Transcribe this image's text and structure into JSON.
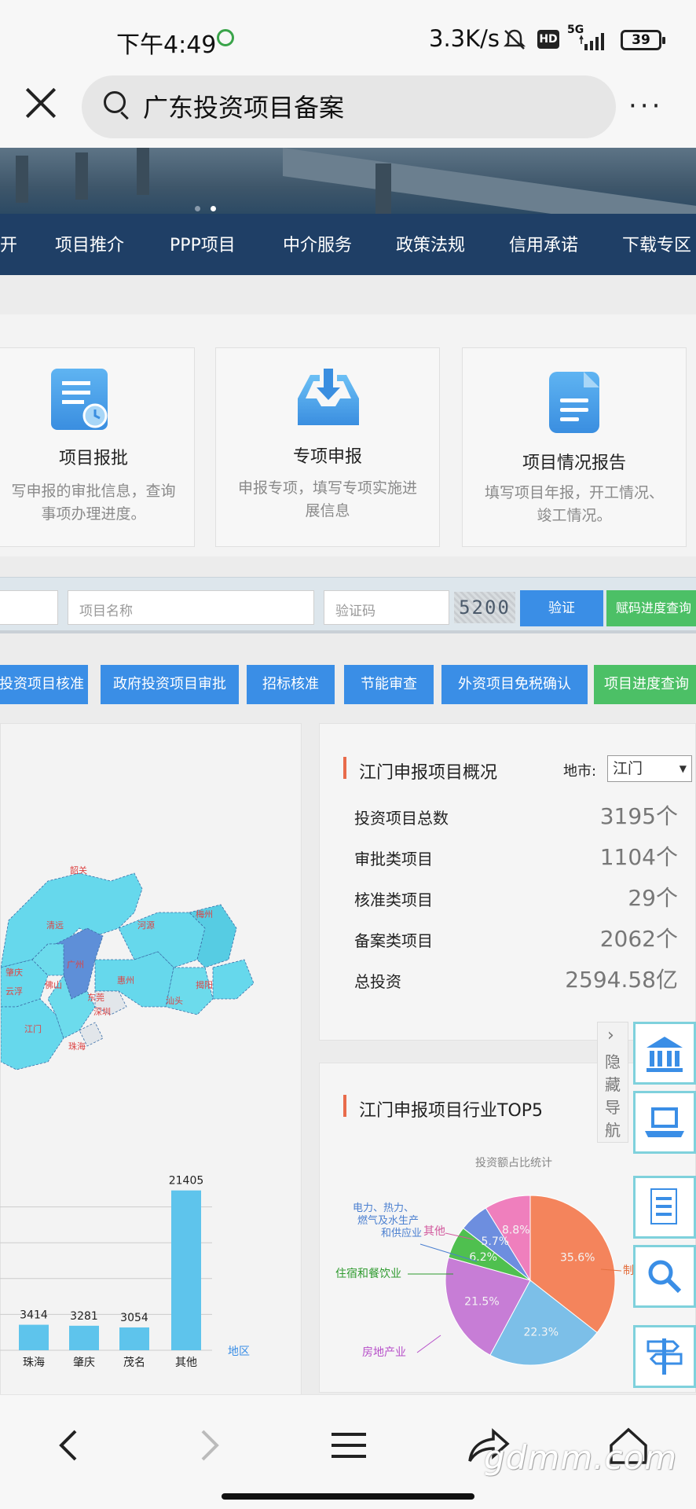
{
  "status_bar": {
    "time": "下午4:49",
    "network_speed": "3.3K/s",
    "hd": "HD",
    "network_type": "5G",
    "battery": "39"
  },
  "browser": {
    "search_query": "广东投资项目备案",
    "more": "···"
  },
  "nav": {
    "items": [
      "开",
      "项目推介",
      "PPP项目",
      "中介服务",
      "政策法规",
      "信用承诺",
      "下载专区"
    ]
  },
  "services": [
    {
      "icon": "document-clock-icon",
      "title": "项目报批",
      "desc_line1": "写申报的审批信息，查询",
      "desc_line2": "事项办理进度。"
    },
    {
      "icon": "inbox-download-icon",
      "title": "专项申报",
      "desc_line1": "申报专项，填写专项实施进",
      "desc_line2": "展信息"
    },
    {
      "icon": "report-doc-icon",
      "title": "项目情况报告",
      "desc_line1": "填写项目年报，开工情况、",
      "desc_line2": "竣工情况。"
    }
  ],
  "query": {
    "project_name_placeholder": "项目名称",
    "captcha_placeholder": "验证码",
    "captcha_image_text": "5200",
    "verify_button": "验证",
    "progress_query_button": "赋码进度查询"
  },
  "categories": [
    "投资项目核准",
    "政府投资项目审批",
    "招标核准",
    "节能审查",
    "外资项目免税确认",
    "项目进度查询"
  ],
  "map": {
    "labels": [
      "韶关",
      "梅州",
      "清远",
      "河源",
      "肇庆",
      "广州",
      "惠州",
      "揭阳",
      "汕头",
      "佛山",
      "东莞",
      "江门",
      "深圳",
      "珠海",
      "云浮"
    ]
  },
  "summary": {
    "title": "江门申报项目概况",
    "city_label": "地市:",
    "city_value": "江门",
    "stats": [
      {
        "label": "投资项目总数",
        "value": "3195个"
      },
      {
        "label": "审批类项目",
        "value": "1104个"
      },
      {
        "label": "核准类项目",
        "value": "29个"
      },
      {
        "label": "备案类项目",
        "value": "2062个"
      },
      {
        "label": "总投资",
        "value": "2594.58亿"
      }
    ]
  },
  "side_toggle": {
    "chars": [
      "隐",
      "藏",
      "导",
      "航"
    ]
  },
  "side_icons": [
    "bank-icon",
    "laptop-icon",
    "list-doc-icon",
    "search-icon",
    "signpost-icon"
  ],
  "top5": {
    "title": "江门申报项目行业TOP5",
    "subtitle": "投资额占比统计"
  },
  "chart_data": [
    {
      "type": "bar",
      "categories": [
        "珠海",
        "肇庆",
        "茂名",
        "其他"
      ],
      "values": [
        3414,
        3281,
        3054,
        21405
      ],
      "xlabel": "地区",
      "ylim": [
        0,
        24000
      ]
    },
    {
      "type": "pie",
      "title": "投资额占比统计",
      "slices": [
        {
          "label": "制造业",
          "value": 35.6,
          "color": "#f4845c"
        },
        {
          "label": "",
          "value": 22.3,
          "color": "#7cbfe8"
        },
        {
          "label": "房地产业",
          "value": 21.5,
          "color": "#c77dd6"
        },
        {
          "label": "住宿和餐饮业",
          "value": 6.2,
          "color": "#4fc04f"
        },
        {
          "label": "电力、热力、燃气及水生产和供应业",
          "value": 5.7,
          "color": "#6d8edf"
        },
        {
          "label": "其他",
          "value": 8.8,
          "color": "#ef7fbd"
        }
      ],
      "pct_labels": [
        "35.6%",
        "22.3%",
        "21.5%",
        "6.2%",
        "5.7%",
        "8.8%"
      ],
      "label_lines": {
        "power": [
          "电力、热力、",
          "燃气及水生产",
          "和供应业"
        ]
      }
    }
  ],
  "watermark": "gdmm.com"
}
